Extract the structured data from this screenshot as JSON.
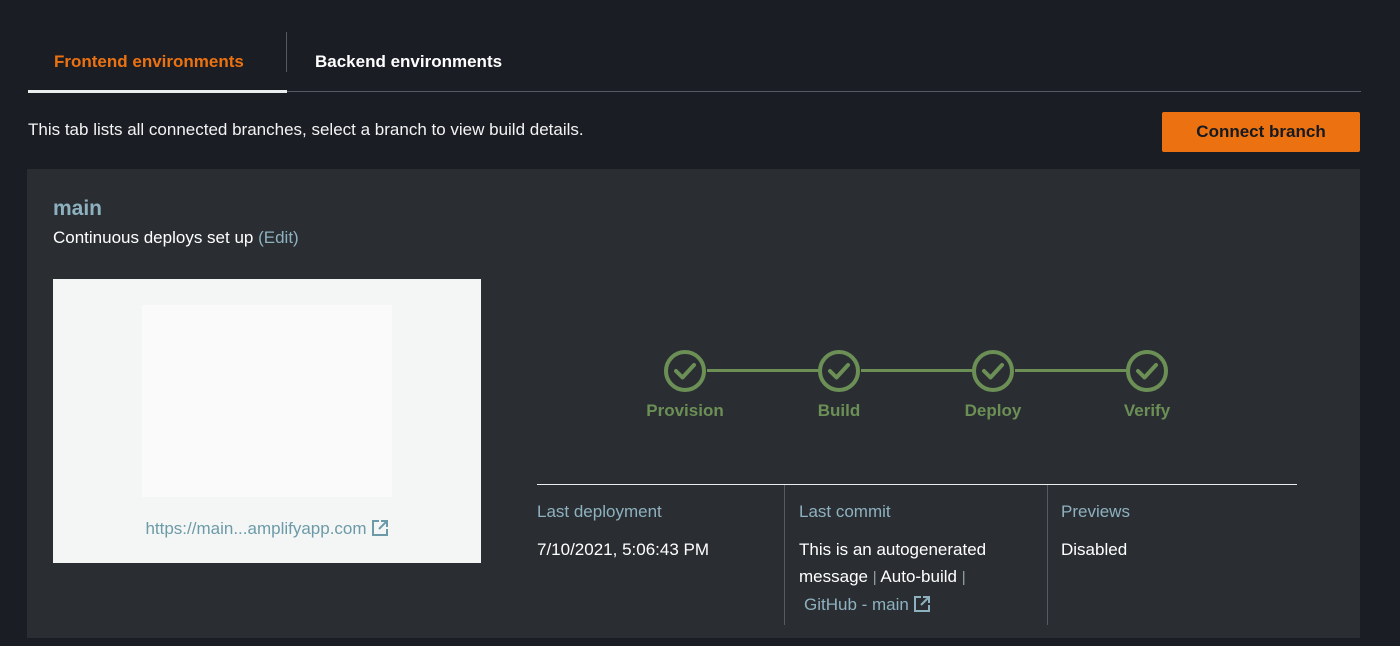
{
  "tabs": [
    {
      "label": "Frontend environments",
      "active": true
    },
    {
      "label": "Backend environments",
      "active": false
    }
  ],
  "description": "This tab lists all connected branches, select a branch to view build details.",
  "connect_button": "Connect branch",
  "branch": {
    "name": "main",
    "deploy_text": "Continuous deploys set up",
    "edit_label": "(Edit)",
    "preview_url": "https://main...amplifyapp.com"
  },
  "steps": [
    {
      "label": "Provision",
      "status": "complete"
    },
    {
      "label": "Build",
      "status": "complete"
    },
    {
      "label": "Deploy",
      "status": "complete"
    },
    {
      "label": "Verify",
      "status": "complete"
    }
  ],
  "details": {
    "last_deployment": {
      "heading": "Last deployment",
      "value": "7/10/2021, 5:06:43 PM"
    },
    "last_commit": {
      "heading": "Last commit",
      "message_part1": "This is an autogenerated",
      "message_part2": "message",
      "separator": "|",
      "autobuild": "Auto-build",
      "repo_link": "GitHub - main"
    },
    "previews": {
      "heading": "Previews",
      "value": "Disabled"
    }
  },
  "colors": {
    "accent": "#ec7211",
    "link": "#8eb1bf",
    "success": "#6b8f55",
    "background": "#1b1d24",
    "card": "#2a2e33"
  },
  "icons": {
    "step": "check-circle-icon",
    "external": "external-link-icon"
  }
}
